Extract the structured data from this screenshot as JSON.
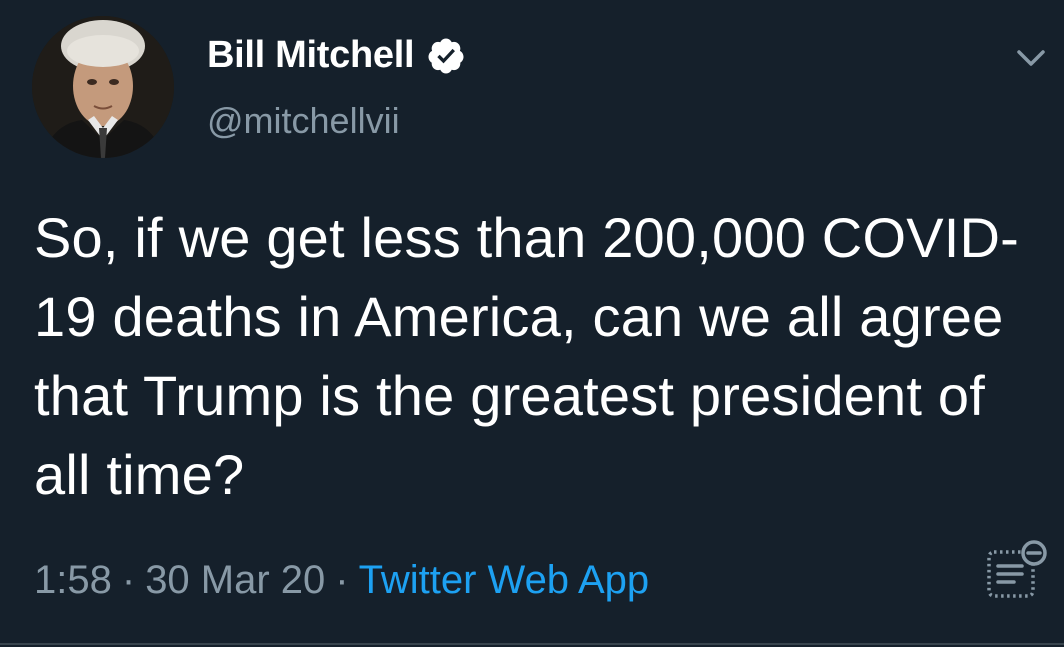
{
  "tweet": {
    "author": {
      "display_name": "Bill Mitchell",
      "handle": "@mitchellvii",
      "verified": true
    },
    "text": "So, if we get less than 200,000 COVID-19 deaths in America, can we all agree that Trump is the greatest president of all time?",
    "time": "1:58",
    "separator": "·",
    "date": "30 Mar 20",
    "source": "Twitter Web App"
  },
  "icons": {
    "verified": "verified-badge-icon",
    "menu": "chevron-down-icon",
    "analytics": "view-analytics-icon"
  },
  "colors": {
    "background": "#15202b",
    "primary_text": "#ffffff",
    "secondary_text": "#8899a6",
    "link": "#1da1f2",
    "divider": "#38444d"
  }
}
